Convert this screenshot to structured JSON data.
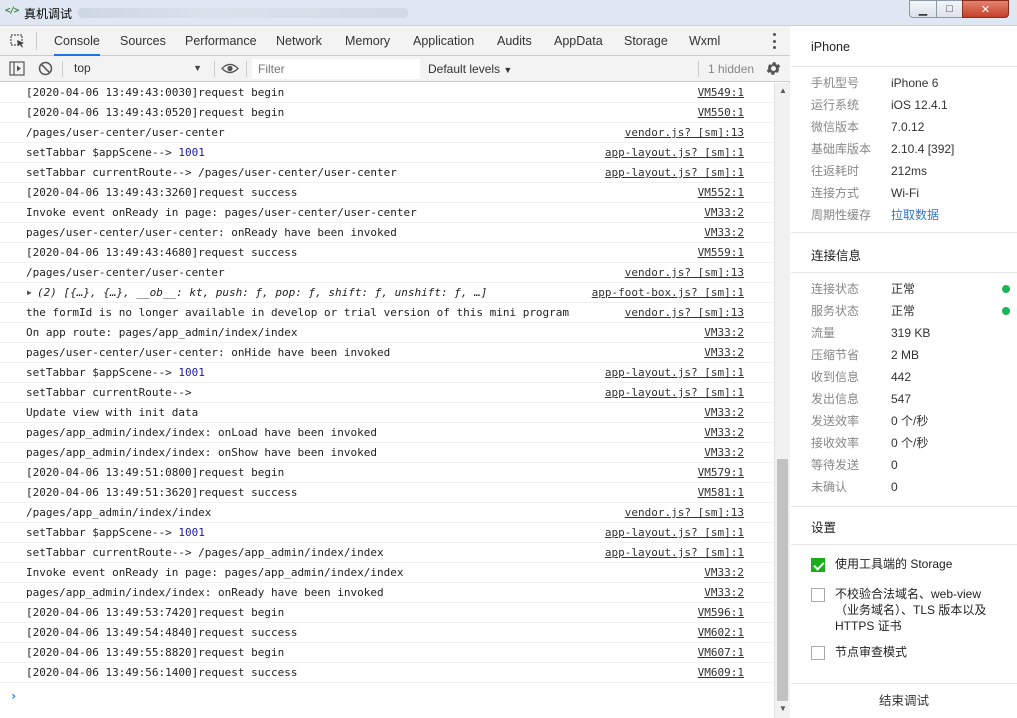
{
  "window": {
    "title": "真机调试",
    "icon": "code-brackets-icon"
  },
  "tabs": [
    "Console",
    "Sources",
    "Performance",
    "Network",
    "Memory",
    "Application",
    "Audits",
    "AppData",
    "Storage",
    "Wxml"
  ],
  "toolbar": {
    "context": "top",
    "filter_placeholder": "Filter",
    "levels": "Default levels",
    "hidden": "1 hidden"
  },
  "console": [
    {
      "msg": "[2020-04-06 13:49:43:0030]request begin",
      "src": "VM549:1"
    },
    {
      "msg": "[2020-04-06 13:49:43:0520]request begin",
      "src": "VM550:1"
    },
    {
      "msg": "/pages/user-center/user-center",
      "src": "vendor.js? [sm]:13"
    },
    {
      "msg": "setTabbar $appScene--> ",
      "num": "1001",
      "src": "app-layout.js? [sm]:1"
    },
    {
      "msg": "setTabbar currentRoute--> /pages/user-center/user-center",
      "src": "app-layout.js? [sm]:1"
    },
    {
      "msg": "[2020-04-06 13:49:43:3260]request success",
      "src": "VM552:1"
    },
    {
      "msg": "Invoke event onReady in page: pages/user-center/user-center",
      "src": "VM33:2"
    },
    {
      "msg": "pages/user-center/user-center: onReady have been invoked",
      "src": "VM33:2"
    },
    {
      "msg": "[2020-04-06 13:49:43:4680]request success",
      "src": "VM559:1"
    },
    {
      "msg": "/pages/user-center/user-center",
      "src": "vendor.js? [sm]:13"
    },
    {
      "msg": "(2) [{…}, {…}, __ob__: kt, push: ƒ, pop: ƒ, shift: ƒ, unshift: ƒ, …]",
      "src": "app-foot-box.js? [sm]:1",
      "obj": true
    },
    {
      "msg": "the formId is no longer available in develop or trial version of this mini program",
      "src": "vendor.js? [sm]:13"
    },
    {
      "msg": "On app route: pages/app_admin/index/index",
      "src": "VM33:2"
    },
    {
      "msg": "pages/user-center/user-center: onHide have been invoked",
      "src": "VM33:2"
    },
    {
      "msg": "setTabbar $appScene--> ",
      "num": "1001",
      "src": "app-layout.js? [sm]:1"
    },
    {
      "msg": "setTabbar currentRoute-->",
      "src": "app-layout.js? [sm]:1"
    },
    {
      "msg": "Update view with init data",
      "src": "VM33:2"
    },
    {
      "msg": "pages/app_admin/index/index: onLoad have been invoked",
      "src": "VM33:2"
    },
    {
      "msg": "pages/app_admin/index/index: onShow have been invoked",
      "src": "VM33:2"
    },
    {
      "msg": "[2020-04-06 13:49:51:0800]request begin",
      "src": "VM579:1"
    },
    {
      "msg": "[2020-04-06 13:49:51:3620]request success",
      "src": "VM581:1"
    },
    {
      "msg": "/pages/app_admin/index/index",
      "src": "vendor.js? [sm]:13"
    },
    {
      "msg": "setTabbar $appScene--> ",
      "num": "1001",
      "src": "app-layout.js? [sm]:1"
    },
    {
      "msg": "setTabbar currentRoute--> /pages/app_admin/index/index",
      "src": "app-layout.js? [sm]:1"
    },
    {
      "msg": "Invoke event onReady in page: pages/app_admin/index/index",
      "src": "VM33:2"
    },
    {
      "msg": "pages/app_admin/index/index: onReady have been invoked",
      "src": "VM33:2"
    },
    {
      "msg": "[2020-04-06 13:49:53:7420]request begin",
      "src": "VM596:1"
    },
    {
      "msg": "[2020-04-06 13:49:54:4840]request success",
      "src": "VM602:1"
    },
    {
      "msg": "[2020-04-06 13:49:55:8820]request begin",
      "src": "VM607:1"
    },
    {
      "msg": "[2020-04-06 13:49:56:1400]request success",
      "src": "VM609:1"
    }
  ],
  "panel": {
    "device_title": "iPhone",
    "device": [
      {
        "k": "手机型号",
        "v": "iPhone 6"
      },
      {
        "k": "运行系统",
        "v": "iOS 12.4.1"
      },
      {
        "k": "微信版本",
        "v": "7.0.12"
      },
      {
        "k": "基础库版本",
        "v": "2.10.4 [392]"
      },
      {
        "k": "往返耗时",
        "v": "212ms"
      },
      {
        "k": "连接方式",
        "v": "Wi-Fi"
      },
      {
        "k": "周期性缓存",
        "v": "拉取数据",
        "link": true
      }
    ],
    "conn_title": "连接信息",
    "conn": [
      {
        "k": "连接状态",
        "v": "正常",
        "dot": true
      },
      {
        "k": "服务状态",
        "v": "正常",
        "dot": true
      },
      {
        "k": "流量",
        "v": "319 KB"
      },
      {
        "k": "压缩节省",
        "v": "2 MB"
      },
      {
        "k": "收到信息",
        "v": "442"
      },
      {
        "k": "发出信息",
        "v": "547"
      },
      {
        "k": "发送效率",
        "v": "0 个/秒"
      },
      {
        "k": "接收效率",
        "v": "0 个/秒"
      },
      {
        "k": "等待发送",
        "v": "0"
      },
      {
        "k": "未确认",
        "v": "0"
      }
    ],
    "settings_title": "设置",
    "settings": [
      {
        "label": "使用工具端的 Storage",
        "checked": true
      },
      {
        "label": "不校验合法域名、web-view（业务域名）、TLS 版本以及 HTTPS 证书",
        "checked": false
      },
      {
        "label": "节点审查模式",
        "checked": false
      }
    ],
    "end_button": "结束调试"
  },
  "colors": {
    "accent": "#1a73e8",
    "status_ok": "#1bb556",
    "link": "#2f76d8",
    "checkbox_on": "#1aad19"
  }
}
